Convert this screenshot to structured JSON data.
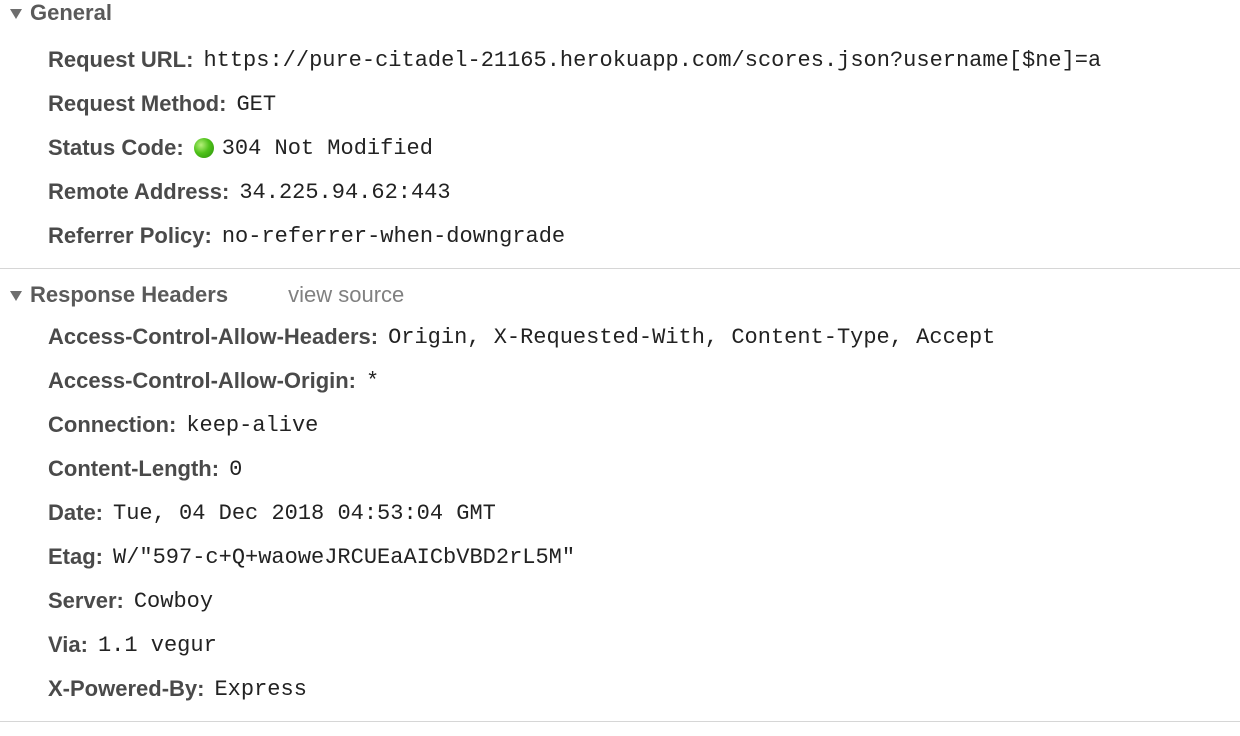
{
  "general": {
    "title": "General",
    "rows": [
      {
        "key": "Request URL:",
        "value": "https://pure-citadel-21165.herokuapp.com/scores.json?username[$ne]=a"
      },
      {
        "key": "Request Method:",
        "value": "GET"
      },
      {
        "key": "Status Code:",
        "value": "304 Not Modified",
        "status_color": "#4fc21a"
      },
      {
        "key": "Remote Address:",
        "value": "34.225.94.62:443"
      },
      {
        "key": "Referrer Policy:",
        "value": "no-referrer-when-downgrade"
      }
    ]
  },
  "response_headers": {
    "title": "Response Headers",
    "view_source_label": "view source",
    "rows": [
      {
        "key": "Access-Control-Allow-Headers:",
        "value": "Origin, X-Requested-With, Content-Type, Accept"
      },
      {
        "key": "Access-Control-Allow-Origin:",
        "value": "*"
      },
      {
        "key": "Connection:",
        "value": "keep-alive"
      },
      {
        "key": "Content-Length:",
        "value": "0"
      },
      {
        "key": "Date:",
        "value": "Tue, 04 Dec 2018 04:53:04 GMT"
      },
      {
        "key": "Etag:",
        "value": "W/\"597-c+Q+waoweJRCUEaAICbVBD2rL5M\""
      },
      {
        "key": "Server:",
        "value": "Cowboy"
      },
      {
        "key": "Via:",
        "value": "1.1 vegur"
      },
      {
        "key": "X-Powered-By:",
        "value": "Express"
      }
    ]
  }
}
